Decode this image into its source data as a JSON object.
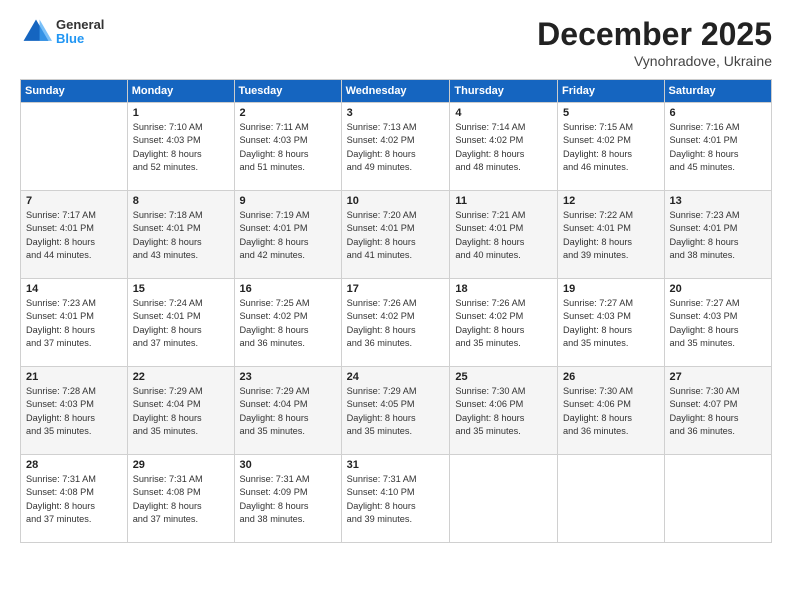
{
  "header": {
    "logo_line1": "General",
    "logo_line2": "Blue",
    "month": "December 2025",
    "location": "Vynohradove, Ukraine"
  },
  "weekdays": [
    "Sunday",
    "Monday",
    "Tuesday",
    "Wednesday",
    "Thursday",
    "Friday",
    "Saturday"
  ],
  "weeks": [
    [
      {
        "day": "",
        "info": ""
      },
      {
        "day": "1",
        "info": "Sunrise: 7:10 AM\nSunset: 4:03 PM\nDaylight: 8 hours\nand 52 minutes."
      },
      {
        "day": "2",
        "info": "Sunrise: 7:11 AM\nSunset: 4:03 PM\nDaylight: 8 hours\nand 51 minutes."
      },
      {
        "day": "3",
        "info": "Sunrise: 7:13 AM\nSunset: 4:02 PM\nDaylight: 8 hours\nand 49 minutes."
      },
      {
        "day": "4",
        "info": "Sunrise: 7:14 AM\nSunset: 4:02 PM\nDaylight: 8 hours\nand 48 minutes."
      },
      {
        "day": "5",
        "info": "Sunrise: 7:15 AM\nSunset: 4:02 PM\nDaylight: 8 hours\nand 46 minutes."
      },
      {
        "day": "6",
        "info": "Sunrise: 7:16 AM\nSunset: 4:01 PM\nDaylight: 8 hours\nand 45 minutes."
      }
    ],
    [
      {
        "day": "7",
        "info": "Sunrise: 7:17 AM\nSunset: 4:01 PM\nDaylight: 8 hours\nand 44 minutes."
      },
      {
        "day": "8",
        "info": "Sunrise: 7:18 AM\nSunset: 4:01 PM\nDaylight: 8 hours\nand 43 minutes."
      },
      {
        "day": "9",
        "info": "Sunrise: 7:19 AM\nSunset: 4:01 PM\nDaylight: 8 hours\nand 42 minutes."
      },
      {
        "day": "10",
        "info": "Sunrise: 7:20 AM\nSunset: 4:01 PM\nDaylight: 8 hours\nand 41 minutes."
      },
      {
        "day": "11",
        "info": "Sunrise: 7:21 AM\nSunset: 4:01 PM\nDaylight: 8 hours\nand 40 minutes."
      },
      {
        "day": "12",
        "info": "Sunrise: 7:22 AM\nSunset: 4:01 PM\nDaylight: 8 hours\nand 39 minutes."
      },
      {
        "day": "13",
        "info": "Sunrise: 7:23 AM\nSunset: 4:01 PM\nDaylight: 8 hours\nand 38 minutes."
      }
    ],
    [
      {
        "day": "14",
        "info": "Sunrise: 7:23 AM\nSunset: 4:01 PM\nDaylight: 8 hours\nand 37 minutes."
      },
      {
        "day": "15",
        "info": "Sunrise: 7:24 AM\nSunset: 4:01 PM\nDaylight: 8 hours\nand 37 minutes."
      },
      {
        "day": "16",
        "info": "Sunrise: 7:25 AM\nSunset: 4:02 PM\nDaylight: 8 hours\nand 36 minutes."
      },
      {
        "day": "17",
        "info": "Sunrise: 7:26 AM\nSunset: 4:02 PM\nDaylight: 8 hours\nand 36 minutes."
      },
      {
        "day": "18",
        "info": "Sunrise: 7:26 AM\nSunset: 4:02 PM\nDaylight: 8 hours\nand 35 minutes."
      },
      {
        "day": "19",
        "info": "Sunrise: 7:27 AM\nSunset: 4:03 PM\nDaylight: 8 hours\nand 35 minutes."
      },
      {
        "day": "20",
        "info": "Sunrise: 7:27 AM\nSunset: 4:03 PM\nDaylight: 8 hours\nand 35 minutes."
      }
    ],
    [
      {
        "day": "21",
        "info": "Sunrise: 7:28 AM\nSunset: 4:03 PM\nDaylight: 8 hours\nand 35 minutes."
      },
      {
        "day": "22",
        "info": "Sunrise: 7:29 AM\nSunset: 4:04 PM\nDaylight: 8 hours\nand 35 minutes."
      },
      {
        "day": "23",
        "info": "Sunrise: 7:29 AM\nSunset: 4:04 PM\nDaylight: 8 hours\nand 35 minutes."
      },
      {
        "day": "24",
        "info": "Sunrise: 7:29 AM\nSunset: 4:05 PM\nDaylight: 8 hours\nand 35 minutes."
      },
      {
        "day": "25",
        "info": "Sunrise: 7:30 AM\nSunset: 4:06 PM\nDaylight: 8 hours\nand 35 minutes."
      },
      {
        "day": "26",
        "info": "Sunrise: 7:30 AM\nSunset: 4:06 PM\nDaylight: 8 hours\nand 36 minutes."
      },
      {
        "day": "27",
        "info": "Sunrise: 7:30 AM\nSunset: 4:07 PM\nDaylight: 8 hours\nand 36 minutes."
      }
    ],
    [
      {
        "day": "28",
        "info": "Sunrise: 7:31 AM\nSunset: 4:08 PM\nDaylight: 8 hours\nand 37 minutes."
      },
      {
        "day": "29",
        "info": "Sunrise: 7:31 AM\nSunset: 4:08 PM\nDaylight: 8 hours\nand 37 minutes."
      },
      {
        "day": "30",
        "info": "Sunrise: 7:31 AM\nSunset: 4:09 PM\nDaylight: 8 hours\nand 38 minutes."
      },
      {
        "day": "31",
        "info": "Sunrise: 7:31 AM\nSunset: 4:10 PM\nDaylight: 8 hours\nand 39 minutes."
      },
      {
        "day": "",
        "info": ""
      },
      {
        "day": "",
        "info": ""
      },
      {
        "day": "",
        "info": ""
      }
    ]
  ]
}
